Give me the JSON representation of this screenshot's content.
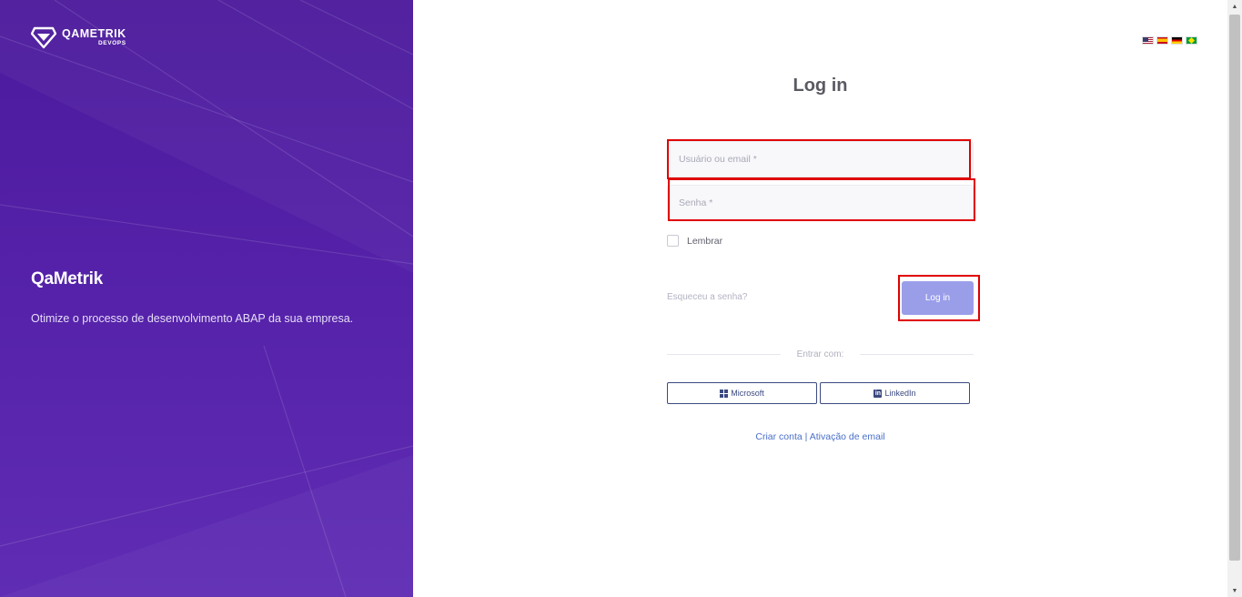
{
  "brand": {
    "logo_main": "QAMETRIK",
    "logo_sub": "DEVOPS",
    "title": "QaMetrik",
    "description": "Otimize o processo de desenvolvimento ABAP da sua empresa."
  },
  "languages": [
    "en",
    "es",
    "de",
    "pt-br"
  ],
  "login": {
    "title": "Log in",
    "username_placeholder": "Usuário ou email *",
    "password_placeholder": "Senha *",
    "remember_label": "Lembrar",
    "forgot_label": "Esqueceu a senha?",
    "submit_label": "Log in",
    "divider_label": "Entrar com:",
    "microsoft_label": "Microsoft",
    "linkedin_label": "LinkedIn",
    "create_account_label": "Criar conta",
    "separator": "|",
    "email_activation_label": "Ativação de email"
  },
  "colors": {
    "left_panel": "#5421a8",
    "highlight": "#e00000",
    "button": "#9a9ee9",
    "link": "#4a6fc9"
  }
}
